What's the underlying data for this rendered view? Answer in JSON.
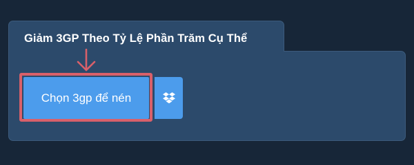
{
  "tab": {
    "title": "Giảm 3GP Theo Tỷ Lệ Phần Trăm Cụ Thể"
  },
  "upload": {
    "choose_label": "Chọn 3gp để nén",
    "dropbox_icon": "dropbox-icon"
  },
  "colors": {
    "page_background": "#172638",
    "panel_background": "#2c4a6b",
    "button_blue": "#4c9cec",
    "highlight_red": "#d9606a"
  }
}
